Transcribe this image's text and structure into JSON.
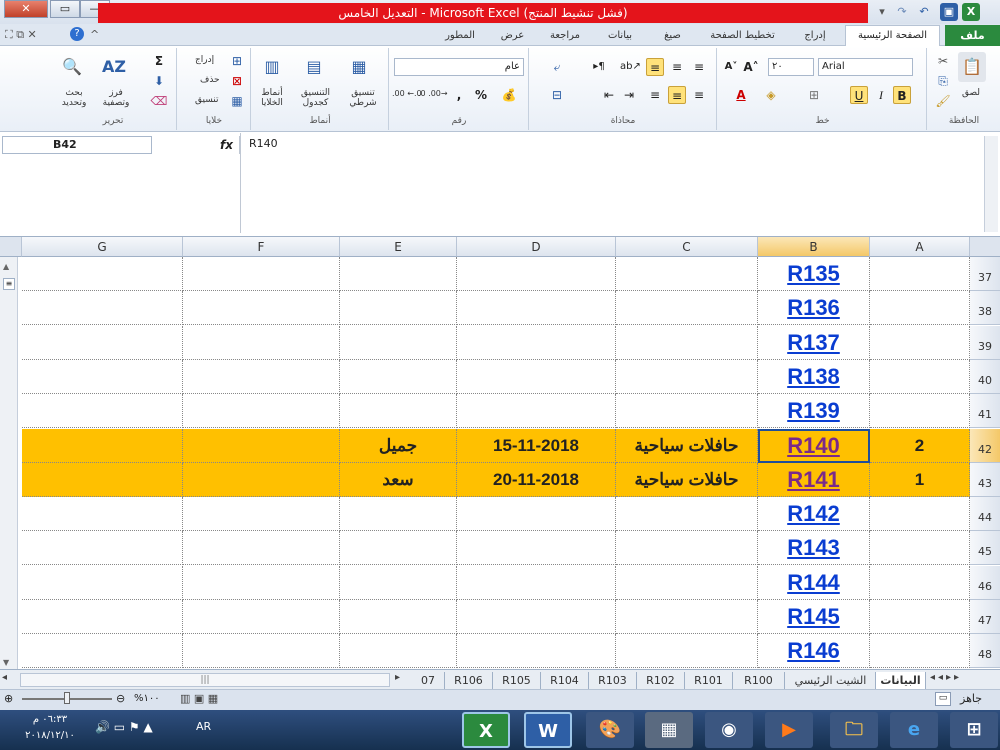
{
  "window": {
    "title": "التعديل الخامس - Microsoft Excel (فشل تنشيط المنتج)"
  },
  "ribbon": {
    "file_tab": "ملف",
    "tabs": [
      "الصفحة الرئيسية",
      "إدراج",
      "تخطيط الصفحة",
      "صيغ",
      "بيانات",
      "مراجعة",
      "عرض",
      "المطور"
    ],
    "groups": {
      "clipboard": "الحافظة",
      "font": "خط",
      "alignment": "محاذاة",
      "number": "رقم",
      "styles": "أنماط",
      "cells": "خلايا",
      "editing": "تحرير"
    },
    "paste_label": "لصق",
    "font_name": "Arial",
    "font_size": "٢٠",
    "number_format": "عام",
    "percent": "%",
    "comma": ",",
    "dec_inc": ".00 ←.0",
    "dec_dec": ".0 .00→",
    "bold": "B",
    "italic": "I",
    "underline": "U",
    "cond_format": "تنسيق شرطي",
    "format_table": "التنسيق كجدول",
    "cell_styles": "أنماط الخلايا",
    "insert": "إدراج",
    "delete": "حذف",
    "format": "تنسيق",
    "sum": "Σ",
    "sort_filter": "فرز وتصفية",
    "find_select": "بحث وتحديد"
  },
  "formula_bar": {
    "name_box": "B42",
    "fx": "fx",
    "value": "R140"
  },
  "columns": [
    "G",
    "F",
    "E",
    "D",
    "C",
    "B",
    "A"
  ],
  "rows": [
    {
      "num": "37",
      "b": "R135",
      "visited": false,
      "highlight": false,
      "a": "",
      "c": "",
      "d": "",
      "e": ""
    },
    {
      "num": "38",
      "b": "R136",
      "visited": false,
      "highlight": false,
      "a": "",
      "c": "",
      "d": "",
      "e": ""
    },
    {
      "num": "39",
      "b": "R137",
      "visited": false,
      "highlight": false,
      "a": "",
      "c": "",
      "d": "",
      "e": ""
    },
    {
      "num": "40",
      "b": "R138",
      "visited": false,
      "highlight": false,
      "a": "",
      "c": "",
      "d": "",
      "e": ""
    },
    {
      "num": "41",
      "b": "R139",
      "visited": false,
      "highlight": false,
      "a": "",
      "c": "",
      "d": "",
      "e": ""
    },
    {
      "num": "42",
      "b": "R140",
      "visited": true,
      "highlight": true,
      "a": "2",
      "c": "حافلات سياحية",
      "d": "15-11-2018",
      "e": "جميل"
    },
    {
      "num": "43",
      "b": "R141",
      "visited": true,
      "highlight": true,
      "a": "1",
      "c": "حافلات سياحية",
      "d": "20-11-2018",
      "e": "سعد"
    },
    {
      "num": "44",
      "b": "R142",
      "visited": false,
      "highlight": false,
      "a": "",
      "c": "",
      "d": "",
      "e": ""
    },
    {
      "num": "45",
      "b": "R143",
      "visited": false,
      "highlight": false,
      "a": "",
      "c": "",
      "d": "",
      "e": ""
    },
    {
      "num": "46",
      "b": "R144",
      "visited": false,
      "highlight": false,
      "a": "",
      "c": "",
      "d": "",
      "e": ""
    },
    {
      "num": "47",
      "b": "R145",
      "visited": false,
      "highlight": false,
      "a": "",
      "c": "",
      "d": "",
      "e": ""
    },
    {
      "num": "48",
      "b": "R146",
      "visited": false,
      "highlight": false,
      "a": "",
      "c": "",
      "d": "",
      "e": ""
    }
  ],
  "sheet_tabs": [
    "البيانات",
    "الشيت الرئيسي",
    "R100",
    "R101",
    "R102",
    "R103",
    "R104",
    "R105",
    "R106",
    "07"
  ],
  "status": {
    "ready": "جاهز",
    "zoom": "%١٠٠"
  },
  "taskbar": {
    "time": "٠٦:٣٣ م",
    "date": "٢٠١٨/١٢/١٠",
    "lang": "AR"
  },
  "colors": {
    "highlight": "#ffc000",
    "link": "#0a3dd1",
    "visited": "#7a2a8a",
    "excel_green": "#2b8a3e"
  }
}
